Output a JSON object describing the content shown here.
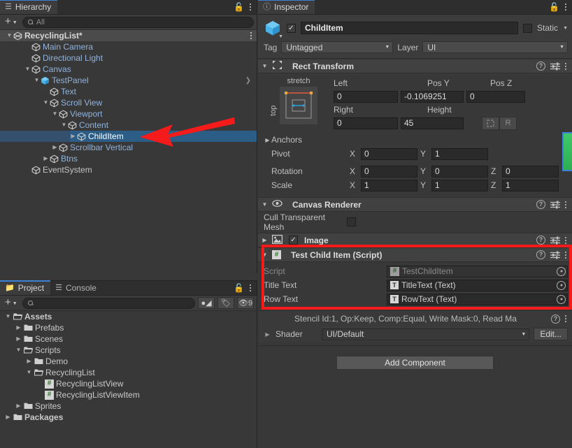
{
  "hierarchy": {
    "tab": {
      "label": "Hierarchy",
      "icon": "hierarchy-list-icon"
    },
    "toolbar": {
      "add_label": "+",
      "search_placeholder": "All",
      "search_value": ""
    },
    "items": [
      {
        "label": "RecyclingList*",
        "indent": 0,
        "arrow": "down",
        "style": "scene",
        "icon": "scene-icon"
      },
      {
        "label": "Main Camera",
        "indent": 2,
        "arrow": "none",
        "style": "blue",
        "icon": "gameobject-icon"
      },
      {
        "label": "Directional Light",
        "indent": 2,
        "arrow": "none",
        "style": "blue",
        "icon": "gameobject-icon"
      },
      {
        "label": "Canvas",
        "indent": 2,
        "arrow": "down",
        "style": "blue",
        "icon": "gameobject-icon"
      },
      {
        "label": "TestPanel",
        "indent": 3,
        "arrow": "down",
        "style": "prefab",
        "icon": "prefab-icon"
      },
      {
        "label": "Text",
        "indent": 4,
        "arrow": "none",
        "style": "blue",
        "icon": "gameobject-icon"
      },
      {
        "label": "Scroll View",
        "indent": 4,
        "arrow": "down",
        "style": "blue",
        "icon": "gameobject-icon"
      },
      {
        "label": "Viewport",
        "indent": 5,
        "arrow": "down",
        "style": "blue",
        "icon": "gameobject-icon"
      },
      {
        "label": "Content",
        "indent": 6,
        "arrow": "down",
        "style": "blue",
        "icon": "gameobject-icon"
      },
      {
        "label": "ChildItem",
        "indent": 7,
        "arrow": "right",
        "style": "selected",
        "icon": "gameobject-icon"
      },
      {
        "label": "Scrollbar Vertical",
        "indent": 5,
        "arrow": "right",
        "style": "blue",
        "icon": "gameobject-icon"
      },
      {
        "label": "Btns",
        "indent": 4,
        "arrow": "right",
        "style": "blue",
        "icon": "gameobject-icon"
      },
      {
        "label": "EventSystem",
        "indent": 2,
        "arrow": "none",
        "style": "plain",
        "icon": "gameobject-icon"
      }
    ]
  },
  "project": {
    "tabs": [
      {
        "label": "Project",
        "icon": "folder-icon",
        "active": true
      },
      {
        "label": "Console",
        "icon": "console-icon",
        "active": false
      }
    ],
    "toolbar": {
      "add_label": "+",
      "search_placeholder": "",
      "search_value": "",
      "filter_type_icon": "asset-type-filter-icon",
      "filter_label_icon": "label-filter-icon",
      "hidden_icon": "hidden-assets-icon",
      "hidden_count": "9"
    },
    "items": [
      {
        "label": "Assets",
        "indent": 0,
        "arrow": "down",
        "icon": "folder-open-icon",
        "bold": true
      },
      {
        "label": "Prefabs",
        "indent": 1,
        "arrow": "right",
        "icon": "folder-icon",
        "bold": false
      },
      {
        "label": "Scenes",
        "indent": 1,
        "arrow": "right",
        "icon": "folder-icon",
        "bold": false
      },
      {
        "label": "Scripts",
        "indent": 1,
        "arrow": "down",
        "icon": "folder-open-icon",
        "bold": false
      },
      {
        "label": "Demo",
        "indent": 2,
        "arrow": "right",
        "icon": "folder-icon",
        "bold": false
      },
      {
        "label": "RecyclingList",
        "indent": 2,
        "arrow": "down",
        "icon": "folder-open-icon",
        "bold": false
      },
      {
        "label": "RecyclingListView",
        "indent": 3,
        "arrow": "none",
        "icon": "cs-script-icon",
        "bold": false
      },
      {
        "label": "RecyclingListViewItem",
        "indent": 3,
        "arrow": "none",
        "icon": "cs-script-icon",
        "bold": false
      },
      {
        "label": "Sprites",
        "indent": 1,
        "arrow": "right",
        "icon": "folder-icon",
        "bold": false
      },
      {
        "label": "Packages",
        "indent": 0,
        "arrow": "right",
        "icon": "folder-icon",
        "bold": true
      }
    ]
  },
  "inspector": {
    "tab": {
      "label": "Inspector",
      "icon": "info-icon"
    },
    "header": {
      "enabled": true,
      "name": "ChildItem",
      "static_label": "Static",
      "static_checked": false,
      "tag_label": "Tag",
      "tag_value": "Untagged",
      "layer_label": "Layer",
      "layer_value": "UI"
    },
    "rect_transform": {
      "title": "Rect Transform",
      "anchor_preset": {
        "top_label": "stretch",
        "side_label": "top"
      },
      "left_label": "Left",
      "left_value": "0",
      "posy_label": "Pos Y",
      "posy_value": "-0.1069251",
      "posz_label": "Pos Z",
      "posz_value": "0",
      "right_label": "Right",
      "right_value": "0",
      "height_label": "Height",
      "height_value": "45",
      "blueprint_toggle": "blueprint-mode-icon",
      "raw_toggle": "R",
      "anchors_label": "Anchors",
      "pivot_label": "Pivot",
      "pivot_x": "0",
      "pivot_y": "1",
      "rotation_label": "Rotation",
      "rotation_x": "0",
      "rotation_y": "0",
      "rotation_z": "0",
      "scale_label": "Scale",
      "scale_x": "1",
      "scale_y": "1",
      "scale_z": "1",
      "axis_x": "X",
      "axis_y": "Y",
      "axis_z": "Z"
    },
    "canvas_renderer": {
      "title": "Canvas Renderer",
      "cull_label": "Cull Transparent Mesh",
      "cull_checked": false
    },
    "image": {
      "title": "Image",
      "enabled": true
    },
    "script_component": {
      "title": "Test Child Item (Script)",
      "rows": [
        {
          "label": "Script",
          "value": "TestChildItem",
          "chip": "cs-script-icon",
          "disabled": true
        },
        {
          "label": "Title Text",
          "value": "TitleText (Text)",
          "chip": "text-component-icon",
          "disabled": false
        },
        {
          "label": "Row Text",
          "value": "RowText (Text)",
          "chip": "text-component-icon",
          "disabled": false
        }
      ]
    },
    "material": {
      "stencil_text": "Stencil Id:1, Op:Keep, Comp:Equal, Write Mask:0, Read Ma",
      "shader_label": "Shader",
      "shader_value": "UI/Default",
      "edit_label": "Edit..."
    },
    "add_component_label": "Add Component"
  },
  "annotations": {
    "arrow": {
      "name": "red-arrow-pointing-to-childitem",
      "color": "#f51b1b"
    },
    "box": {
      "name": "red-highlight-box-script-component",
      "color": "#f51b1b"
    }
  }
}
